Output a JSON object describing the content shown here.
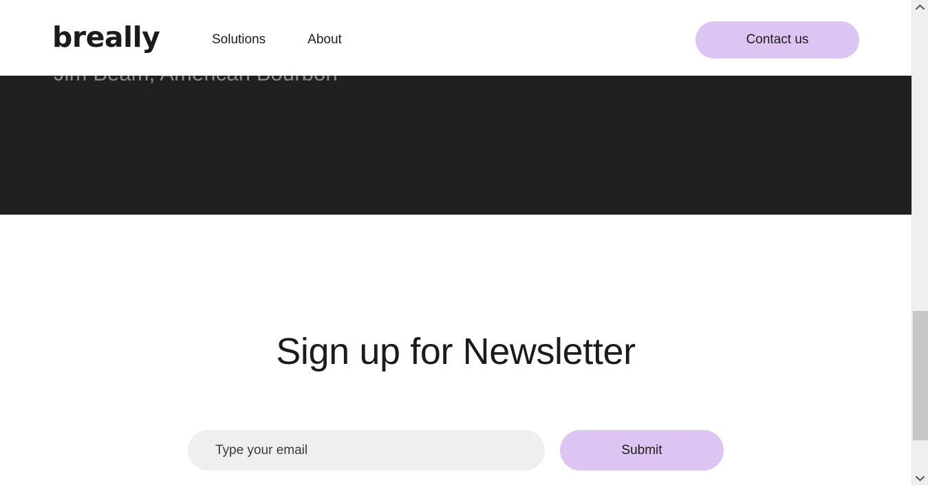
{
  "header": {
    "logo_text": "breally",
    "nav": [
      {
        "label": "Solutions"
      },
      {
        "label": "About"
      }
    ],
    "contact_button": "Contact us"
  },
  "hero": {
    "caption": "Jim Beam, American Bourbon",
    "background_color": "#221F1F",
    "caption_color": "#8c8c8c"
  },
  "newsletter": {
    "title": "Sign up for Newsletter",
    "email_placeholder": "Type your email",
    "email_value": "",
    "submit_button": "Submit"
  },
  "theme": {
    "accent": "#DCC5F2",
    "text": "#1b1b1b",
    "input_bg": "#EFEFEF",
    "page_bg": "#FFFFFF"
  },
  "scrollbar": {
    "up_arrow_icon": "chevron-up-icon",
    "down_arrow_icon": "chevron-down-icon"
  }
}
